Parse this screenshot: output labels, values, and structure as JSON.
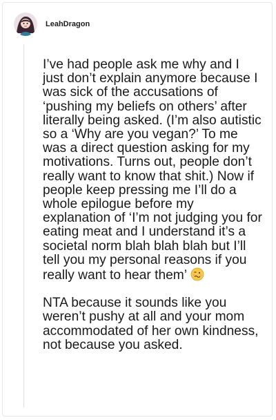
{
  "comment": {
    "author": "LeahDragon",
    "paragraph_1": "I’ve had people ask me why and I just don’t explain anymore because I was sick of the accusations of ‘pushing my beliefs on others’ after literally being asked. (I’m also autistic so a ‘Why are you vegan?’ To me was a direct question asking for my motivations. Turns out, people don’t really want to know that shit.) Now if people keep pressing me I’ll do a whole epilogue before my explanation of ‘I’m not judging you for eating meat and I understand it’s a societal norm blah blah blah but I’ll tell you my personal reasons if you really want to hear them’",
    "paragraph_1_emoji": "woozy-face-emoji",
    "paragraph_2": "NTA because it sounds like you weren’t pushy at all and your mom accommodated of her own kindness, not because you asked."
  },
  "colors": {
    "text": "#1a1a1b",
    "thread_line": "#e0e0e0",
    "emoji_face": "#f7c948",
    "avatar_bg": "#e9e1e6"
  }
}
